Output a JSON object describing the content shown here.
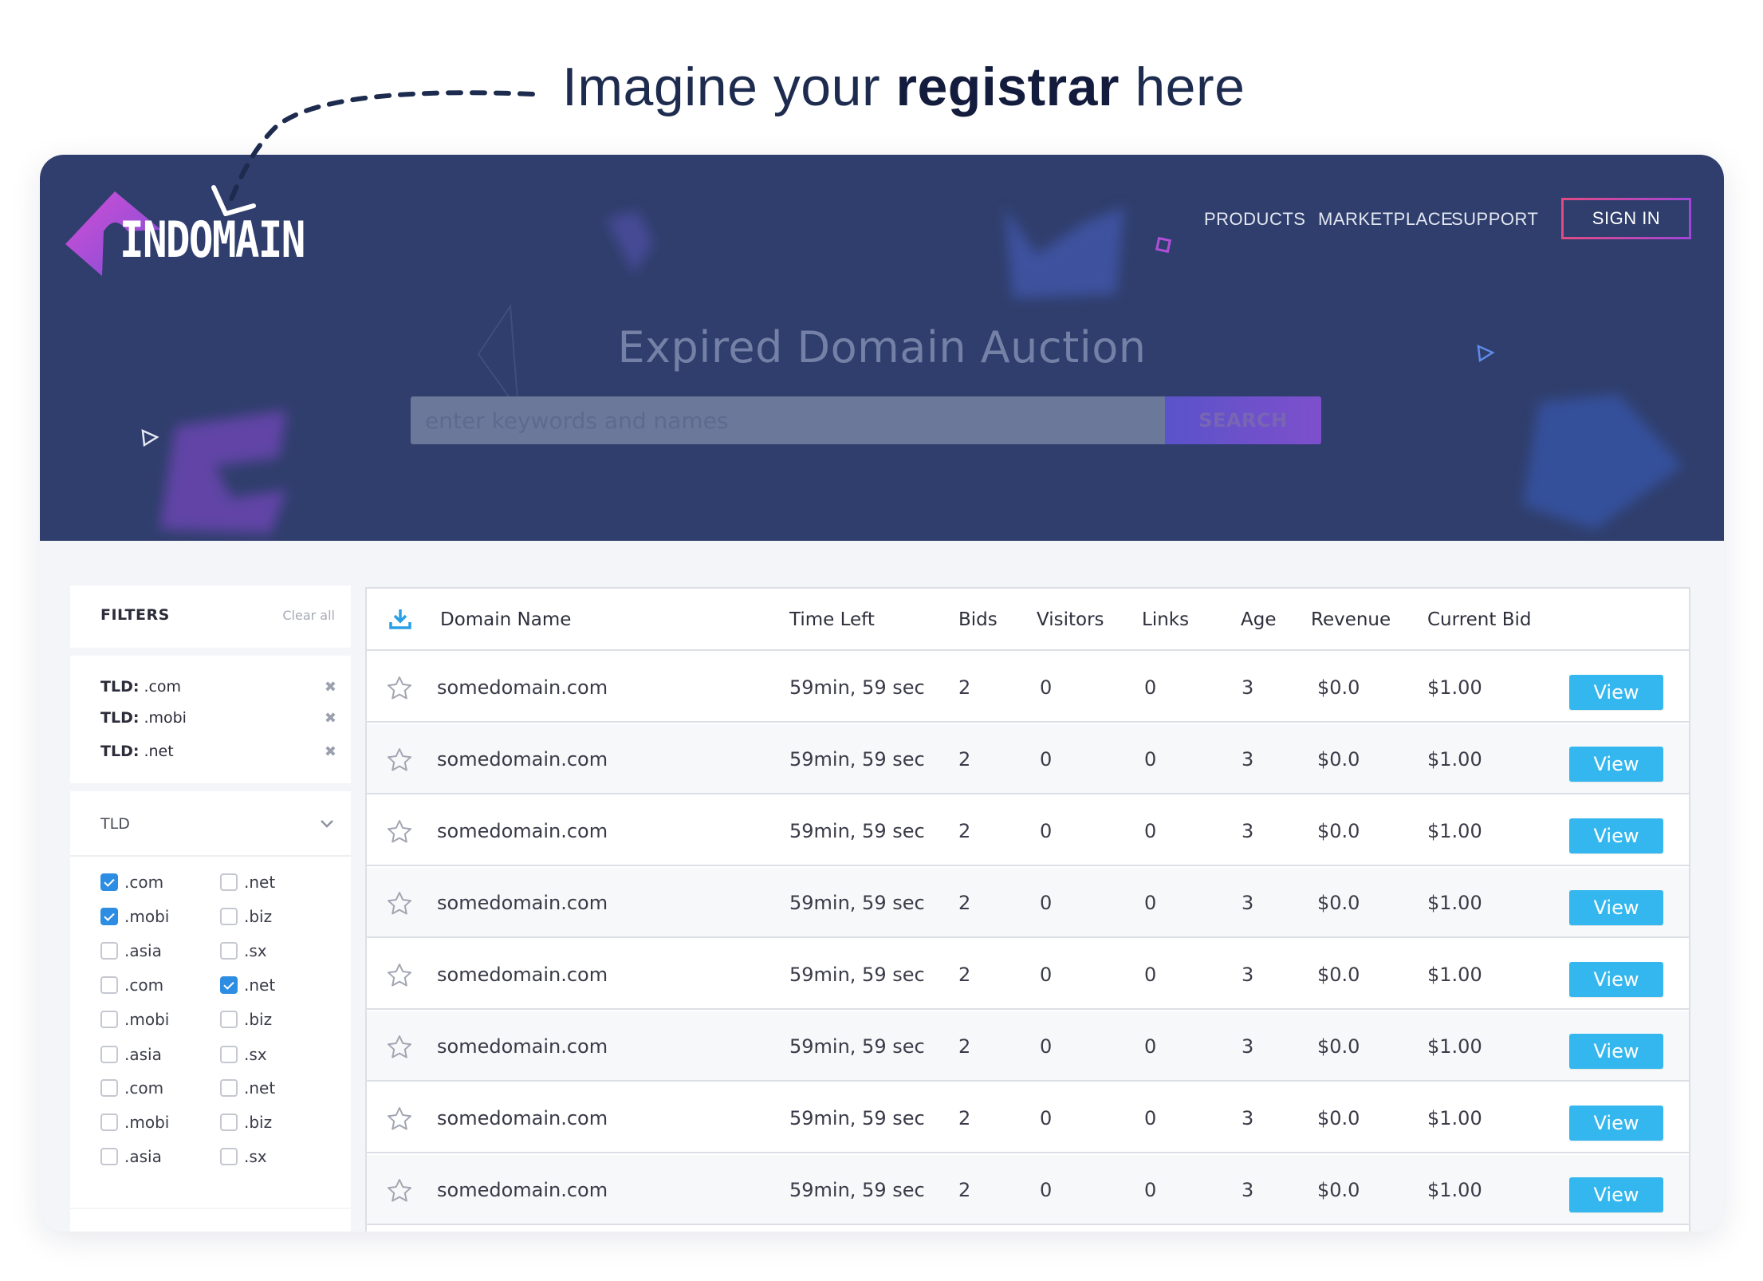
{
  "caption": {
    "prefix": "Imagine your",
    "bold": "registrar",
    "suffix": "here"
  },
  "brand": {
    "name": "INDOMAIN"
  },
  "nav": {
    "products": "PRODUCTS",
    "marketplace": "MARKETPLACE",
    "support": "SUPPORT",
    "signin": "SIGN IN"
  },
  "hero": {
    "title": "Expired Domain Auction",
    "search_placeholder": "enter keywords and names",
    "search_button": "SEARCH"
  },
  "filters": {
    "title": "FILTERS",
    "clear_all": "Clear all",
    "active": [
      {
        "key": "TLD:",
        "value": ".com"
      },
      {
        "key": "TLD:",
        "value": ".mobi"
      },
      {
        "key": "TLD:",
        "value": ".net"
      }
    ],
    "tld_title": "TLD",
    "tld_options": [
      {
        "label": ".com",
        "checked": true
      },
      {
        "label": ".net",
        "checked": false
      },
      {
        "label": ".mobi",
        "checked": true
      },
      {
        "label": ".biz",
        "checked": false
      },
      {
        "label": ".asia",
        "checked": false
      },
      {
        "label": ".sx",
        "checked": false
      },
      {
        "label": ".com",
        "checked": false
      },
      {
        "label": ".net",
        "checked": true
      },
      {
        "label": ".mobi",
        "checked": false
      },
      {
        "label": ".biz",
        "checked": false
      },
      {
        "label": ".asia",
        "checked": false
      },
      {
        "label": ".sx",
        "checked": false
      },
      {
        "label": ".com",
        "checked": false
      },
      {
        "label": ".net",
        "checked": false
      },
      {
        "label": ".mobi",
        "checked": false
      },
      {
        "label": ".biz",
        "checked": false
      },
      {
        "label": ".asia",
        "checked": false
      },
      {
        "label": ".sx",
        "checked": false
      }
    ]
  },
  "table": {
    "columns": {
      "domain": "Domain Name",
      "time": "Time Left",
      "bids": "Bids",
      "visitors": "Visitors",
      "links": "Links",
      "age": "Age",
      "revenue": "Revenue",
      "bid": "Current Bid"
    },
    "view_label": "View",
    "rows": [
      {
        "domain": "somedomain.com",
        "time": "59min, 59 sec",
        "bids": "2",
        "visitors": "0",
        "links": "0",
        "age": "3",
        "revenue": "$0.0",
        "bid": "$1.00"
      },
      {
        "domain": "somedomain.com",
        "time": "59min, 59 sec",
        "bids": "2",
        "visitors": "0",
        "links": "0",
        "age": "3",
        "revenue": "$0.0",
        "bid": "$1.00"
      },
      {
        "domain": "somedomain.com",
        "time": "59min, 59 sec",
        "bids": "2",
        "visitors": "0",
        "links": "0",
        "age": "3",
        "revenue": "$0.0",
        "bid": "$1.00"
      },
      {
        "domain": "somedomain.com",
        "time": "59min, 59 sec",
        "bids": "2",
        "visitors": "0",
        "links": "0",
        "age": "3",
        "revenue": "$0.0",
        "bid": "$1.00"
      },
      {
        "domain": "somedomain.com",
        "time": "59min, 59 sec",
        "bids": "2",
        "visitors": "0",
        "links": "0",
        "age": "3",
        "revenue": "$0.0",
        "bid": "$1.00"
      },
      {
        "domain": "somedomain.com",
        "time": "59min, 59 sec",
        "bids": "2",
        "visitors": "0",
        "links": "0",
        "age": "3",
        "revenue": "$0.0",
        "bid": "$1.00"
      },
      {
        "domain": "somedomain.com",
        "time": "59min, 59 sec",
        "bids": "2",
        "visitors": "0",
        "links": "0",
        "age": "3",
        "revenue": "$0.0",
        "bid": "$1.00"
      },
      {
        "domain": "somedomain.com",
        "time": "59min, 59 sec",
        "bids": "2",
        "visitors": "0",
        "links": "0",
        "age": "3",
        "revenue": "$0.0",
        "bid": "$1.00"
      }
    ]
  },
  "colors": {
    "hero_bg": "#2f3e6c",
    "accent_blue": "#34b7ee",
    "checkbox_blue": "#2d8de2",
    "signin_border": "#e24a84"
  }
}
